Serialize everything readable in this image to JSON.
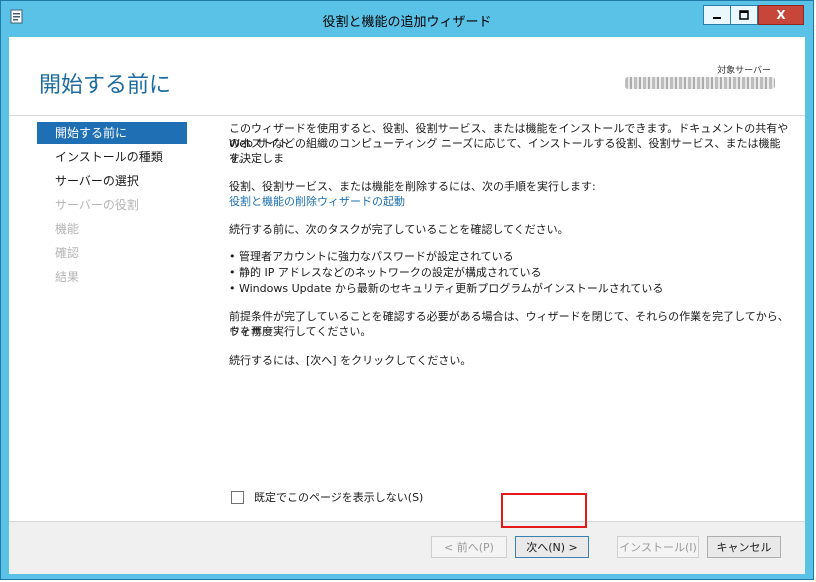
{
  "window": {
    "title": "役割と機能の追加ウィザード",
    "minimize_label": "",
    "close_label": "X"
  },
  "header": {
    "page_title": "開始する前に",
    "target_server_label": "対象サーバー"
  },
  "sidebar": {
    "items": [
      {
        "label": "開始する前に",
        "state": "active"
      },
      {
        "label": "インストールの種類",
        "state": "enabled"
      },
      {
        "label": "サーバーの選択",
        "state": "enabled"
      },
      {
        "label": "サーバーの役割",
        "state": "disabled"
      },
      {
        "label": "機能",
        "state": "disabled"
      },
      {
        "label": "確認",
        "state": "disabled"
      },
      {
        "label": "結果",
        "state": "disabled"
      }
    ]
  },
  "content": {
    "intro_line1": "このウィザードを使用すると、役割、役割サービス、または機能をインストールできます。ドキュメントの共有や Web サイト",
    "intro_line2": "のホストなどの組織のコンピューティング ニーズに応じて、インストールする役割、役割サービス、または機能を決定しま",
    "intro_line3": "す。",
    "remove_line": "役割、役割サービス、または機能を削除するには、次の手順を実行します:",
    "remove_link": "役割と機能の削除ウィザードの起動",
    "confirm_line": "続行する前に、次のタスクが完了していることを確認してください。",
    "bullets": [
      "• 管理者アカウントに強力なパスワードが設定されている",
      "• 静的 IP アドレスなどのネットワークの設定が構成されている",
      "• Windows Update から最新のセキュリティ更新プログラムがインストールされている"
    ],
    "prereq_line1": "前提条件が完了していることを確認する必要がある場合は、ウィザードを閉じて、それらの作業を完了してから、ウィザー",
    "prereq_line2": "ドを再度実行してください。",
    "continue_line": "続行するには、[次へ] をクリックしてください。"
  },
  "checkbox": {
    "label": "既定でこのページを表示しない(S)",
    "checked": false
  },
  "footer": {
    "back_label": "< 前へ(P)",
    "next_label": "次へ(N) >",
    "install_label": "インストール(I)",
    "cancel_label": "キャンセル"
  },
  "colors": {
    "titlebar": "#5bc2e7",
    "accent": "#1f6fb5",
    "link": "#1a6fb0",
    "highlight": "#e41a1a"
  }
}
